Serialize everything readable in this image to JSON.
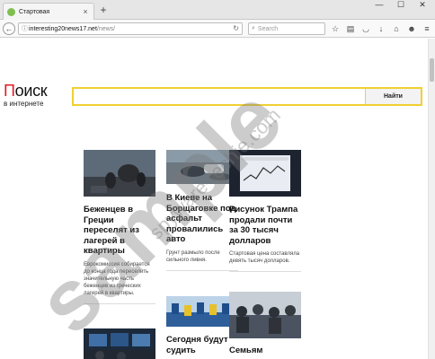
{
  "browser": {
    "tab": {
      "title": "Стартовая"
    },
    "newtab_label": "+",
    "window_controls": {
      "minimize": "—",
      "maximize": "☐",
      "close": "✕"
    },
    "url": {
      "host": "interesting20news17.net",
      "path": "/news/"
    },
    "search": {
      "placeholder": "Search"
    },
    "toolbar_icons": [
      "star-icon",
      "reading-list-icon",
      "pocket-icon",
      "download-icon",
      "home-icon",
      "account-icon",
      "menu-icon"
    ]
  },
  "page": {
    "logo": {
      "first_letter": "П",
      "rest": "оиск",
      "subtitle": "в интернете"
    },
    "search_button": "Найти",
    "articles": [
      {
        "title": "Беженцев в Греции переселят из лагерей в квартиры",
        "description": "Еврокомиссия собирается до конца года переселить значительную часть беженцев из греческих лагерей в квартиры."
      },
      {
        "title": "В Киеве на Борщаговке под асфальт провалились авто",
        "description": "Грунт размыло после сильного ливня."
      },
      {
        "title": "Рисунок Трампа продали почти за 30 тысяч долларов",
        "description": "Стартовая цена составляла девять тысяч долларов."
      },
      {
        "title": "Сегодня будут судить"
      },
      {
        "title": "Семьям"
      }
    ]
  },
  "watermark": {
    "big": "sample",
    "small": "spyware-techie.com"
  }
}
